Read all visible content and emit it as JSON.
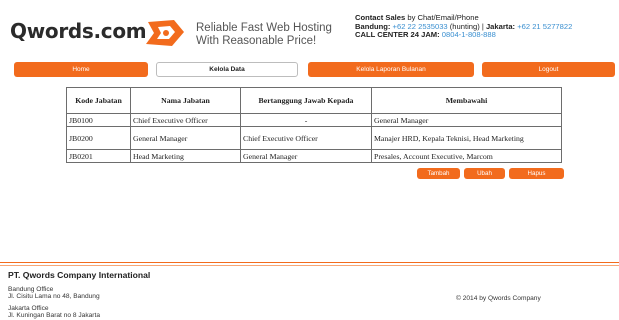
{
  "header": {
    "logo_text": "Qwords.com",
    "tagline_line1": "Reliable Fast Web Hosting",
    "tagline_line2": "With Reasonable Price!",
    "contact": {
      "sales_label": "Contact Sales",
      "sales_suffix": " by Chat/Email/Phone",
      "bandung_label": "Bandung:",
      "bandung_phone": " +62 22 2535033",
      "bandung_hunting": " (hunting) | ",
      "jakarta_label": "Jakarta:",
      "jakarta_phone": " +62 21 5277822",
      "callcenter_label": "CALL CENTER 24 JAM:",
      "callcenter_phone": " 0804-1-808-888"
    },
    "brand_color": "#f26b1d"
  },
  "nav": {
    "items": [
      {
        "label": "Home",
        "active": false
      },
      {
        "label": "Kelola Data",
        "active": true
      },
      {
        "label": "Kelola Laporan Bulanan",
        "active": false
      },
      {
        "label": "Logout",
        "active": false
      }
    ]
  },
  "table": {
    "headers": [
      "Kode Jabatan",
      "Nama Jabatan",
      "Bertanggung Jawab Kepada",
      "Membawahi"
    ],
    "rows": [
      [
        "JB0100",
        "Chief Executive Officer",
        "-",
        "General Manager"
      ],
      [
        "JB0200",
        "General Manager",
        "Chief Executive Officer",
        "Manajer HRD, Kepala Teknisi, Head Marketing"
      ],
      [
        "JB0201",
        "Head Marketing",
        "General Manager",
        "Presales, Account Executive, Marcom"
      ]
    ]
  },
  "actions": {
    "tambah": "Tambah",
    "ubah": "Ubah",
    "hapus": "Hapus"
  },
  "footer": {
    "company": "PT. Qwords Company International",
    "bandung_office": "Bandung Office",
    "bandung_address": "Jl. Cisitu Lama no 48, Bandung",
    "jakarta_office": "Jakarta Office",
    "jakarta_address": "Jl. Kuningan Barat no 8 Jakarta",
    "copyright": "© 2014 by Qwords Company"
  }
}
